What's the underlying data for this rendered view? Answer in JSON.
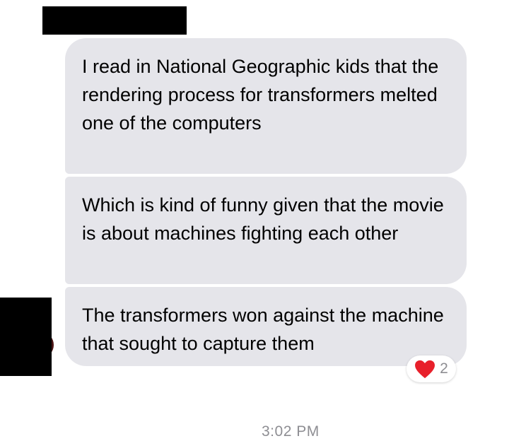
{
  "conversation": {
    "messages": [
      {
        "text": "I read in National Geographic kids that the rendering process for transformers melted one of the computers"
      },
      {
        "text": "Which is kind of funny given that the movie is about machines fighting each other"
      },
      {
        "text": "The transformers won against the machine that sought to capture them"
      }
    ],
    "reaction": {
      "icon": "heart-icon",
      "count": "2",
      "color": "#e8202b"
    },
    "timestamp": "3:02 PM"
  }
}
